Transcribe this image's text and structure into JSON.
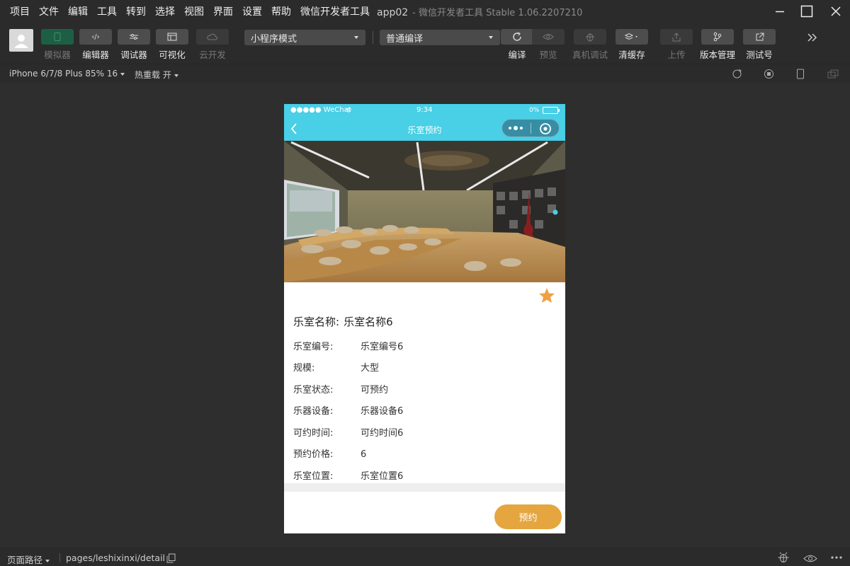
{
  "menubar": {
    "items": [
      "项目",
      "文件",
      "编辑",
      "工具",
      "转到",
      "选择",
      "视图",
      "界面",
      "设置",
      "帮助",
      "微信开发者工具"
    ],
    "app_name": "app02",
    "app_title": "- 微信开发者工具 Stable 1.06.2207210"
  },
  "toolbar": {
    "simulator": "模拟器",
    "editor": "编辑器",
    "debugger": "调试器",
    "visual": "可视化",
    "cloud": "云开发",
    "mode_select": "小程序模式",
    "compile_select": "普通编译",
    "compile": "编译",
    "preview": "预览",
    "remote_debug": "真机调试",
    "clear_cache": "清缓存",
    "upload": "上传",
    "version": "版本管理",
    "test_account": "测试号",
    "editor_glyph": "‹/›"
  },
  "subbar": {
    "device": "iPhone 6/7/8 Plus 85% 16",
    "hot_reload": "热重载 开"
  },
  "phone": {
    "status": {
      "carrier": "●●●●● WeChat",
      "time": "9:34",
      "battery": "0%"
    },
    "nav_title": "乐室预约",
    "name_label": "乐室名称:",
    "name_value": "乐室名称6",
    "fields": [
      {
        "label": "乐室编号:",
        "value": "乐室编号6"
      },
      {
        "label": "规模:",
        "value": "大型"
      },
      {
        "label": "乐室状态:",
        "value": "可预约"
      },
      {
        "label": "乐器设备:",
        "value": "乐器设备6"
      },
      {
        "label": "可约时间:",
        "value": "可约时间6"
      },
      {
        "label": "预约价格:",
        "value": "6"
      },
      {
        "label": "乐室位置:",
        "value": "乐室位置6"
      }
    ],
    "book_button": "预约"
  },
  "bottombar": {
    "page_path_label": "页面路径",
    "path": "pages/leshixinxi/detail"
  },
  "colors": {
    "nav": "#49cfe6",
    "accent_button": "#e5a640",
    "star": "#f0a040",
    "background": "#2e2e2e"
  }
}
